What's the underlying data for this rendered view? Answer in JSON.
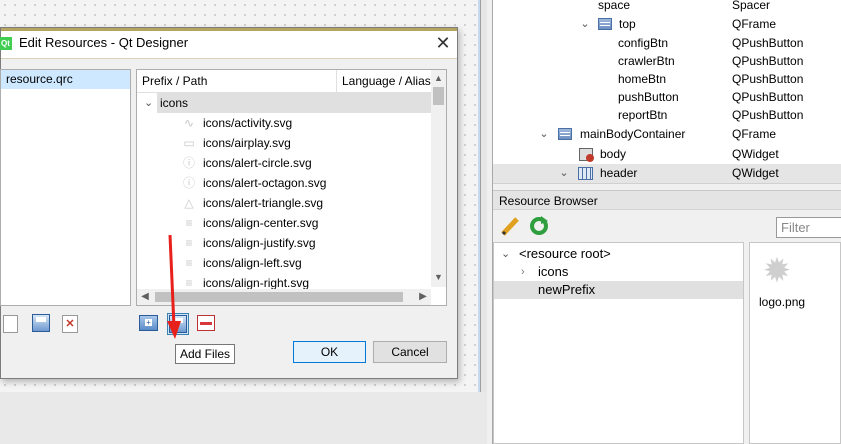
{
  "object_inspector": {
    "rows": [
      {
        "name": "space",
        "class": "Spacer"
      },
      {
        "name": "top",
        "class": "QFrame"
      },
      {
        "name": "configBtn",
        "class": "QPushButton"
      },
      {
        "name": "crawlerBtn",
        "class": "QPushButton"
      },
      {
        "name": "homeBtn",
        "class": "QPushButton"
      },
      {
        "name": "pushButton",
        "class": "QPushButton"
      },
      {
        "name": "reportBtn",
        "class": "QPushButton"
      },
      {
        "name": "mainBodyContainer",
        "class": "QFrame"
      },
      {
        "name": "body",
        "class": "QWidget"
      },
      {
        "name": "header",
        "class": "QWidget"
      }
    ]
  },
  "resource_browser": {
    "title": "Resource Browser",
    "filter_placeholder": "Filter",
    "tree": [
      {
        "label": "<resource root>"
      },
      {
        "label": "icons"
      },
      {
        "label": "newPrefix"
      }
    ],
    "files": [
      {
        "label": "logo.png"
      }
    ]
  },
  "dialog": {
    "app_icon": "Qt",
    "title": "Edit Resources - Qt Designer",
    "close_glyph": "✕",
    "qrc_files": [
      {
        "label": "resource.qrc"
      }
    ],
    "columns": {
      "prefix": "Prefix / Path",
      "language": "Language / Alias"
    },
    "prefix": "icons",
    "files": [
      {
        "label": "icons/activity.svg",
        "icon": "activity-icon",
        "glyph": "∿"
      },
      {
        "label": "icons/airplay.svg",
        "icon": "airplay-icon",
        "glyph": "▭"
      },
      {
        "label": "icons/alert-circle.svg",
        "icon": "alert-circle-icon",
        "glyph": "ⓘ"
      },
      {
        "label": "icons/alert-octagon.svg",
        "icon": "alert-octagon-icon",
        "glyph": "ⓘ"
      },
      {
        "label": "icons/alert-triangle.svg",
        "icon": "alert-triangle-icon",
        "glyph": "△"
      },
      {
        "label": "icons/align-center.svg",
        "icon": "align-center-icon",
        "glyph": "≡"
      },
      {
        "label": "icons/align-justify.svg",
        "icon": "align-justify-icon",
        "glyph": "≡"
      },
      {
        "label": "icons/align-left.svg",
        "icon": "align-left-icon",
        "glyph": "≡"
      },
      {
        "label": "icons/align-right.svg",
        "icon": "align-right-icon",
        "glyph": "≡"
      }
    ],
    "tooltip": "Add Files",
    "ok_label": "OK",
    "cancel_label": "Cancel",
    "remove_glyph": "✕"
  },
  "colors": {
    "selection": "#cde8ff",
    "title_accent": "#b5a55e",
    "arrow": "#e8201c",
    "qt_green": "#41cd52"
  }
}
